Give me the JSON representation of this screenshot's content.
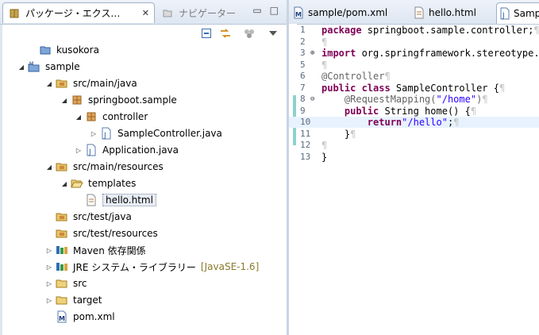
{
  "left_panel": {
    "tabs": [
      {
        "label": "パッケージ・エクス…",
        "close": "✕"
      },
      {
        "label": "ナビゲーター",
        "close": "✕"
      }
    ],
    "window_controls": {
      "minimize": "▭",
      "maximize": "□"
    },
    "toolbar_icons": [
      "collapse-all-icon",
      "link-with-editor-icon",
      "filters-icon",
      "view-menu-icon"
    ],
    "tree": [
      {
        "label": "kusokora"
      },
      {
        "label": "sample"
      },
      {
        "label": "src/main/java"
      },
      {
        "label": "springboot.sample"
      },
      {
        "label": "controller"
      },
      {
        "label": "SampleController.java"
      },
      {
        "label": "Application.java"
      },
      {
        "label": "src/main/resources"
      },
      {
        "label": "templates"
      },
      {
        "label": "hello.html"
      },
      {
        "label": "src/test/java"
      },
      {
        "label": "src/test/resources"
      },
      {
        "label": "Maven 依存関係"
      },
      {
        "label": "JRE システム・ライブラリー",
        "suffix": "[JavaSE-1.6]"
      },
      {
        "label": "src"
      },
      {
        "label": "target"
      },
      {
        "label": "pom.xml"
      }
    ]
  },
  "editor": {
    "tabs": [
      {
        "label": "sample/pom.xml"
      },
      {
        "label": "hello.html"
      },
      {
        "label": "SampleController.java"
      }
    ],
    "lines": [
      {
        "num": "1",
        "parts": [
          [
            "kw",
            "package"
          ],
          [
            "",
            "springboot.sample.controller;"
          ],
          [
            "pm",
            "¶"
          ]
        ]
      },
      {
        "num": "2",
        "parts": [
          [
            "pm",
            "¶"
          ]
        ]
      },
      {
        "num": "3",
        "parts": [
          [
            "kw",
            "import"
          ],
          [
            "",
            "org.springframework.stereotype.C"
          ]
        ],
        "fold": "⊕"
      },
      {
        "num": "5",
        "parts": [
          [
            "pm",
            "¶"
          ]
        ]
      },
      {
        "num": "6",
        "parts": [
          [
            "an",
            "@Controller"
          ],
          [
            "pm",
            "¶"
          ]
        ]
      },
      {
        "num": "7",
        "parts": [
          [
            "kw",
            "public class"
          ],
          [
            "",
            "SampleController {"
          ],
          [
            "pm",
            "¶"
          ]
        ]
      },
      {
        "num": "8",
        "parts": [
          [
            "an",
            "    @RequestMapping("
          ],
          [
            "st",
            "\"/home\""
          ],
          [
            "an",
            ")"
          ],
          [
            "pm",
            "¶"
          ]
        ],
        "fold": "⊖"
      },
      {
        "num": "9",
        "parts": [
          [
            "kw",
            "    public"
          ],
          [
            "",
            "String home() {"
          ],
          [
            "pm",
            "¶"
          ]
        ]
      },
      {
        "num": "10",
        "parts": [
          [
            "kw",
            "        return"
          ],
          [
            "st",
            "\"/hello\""
          ],
          [
            "",
            ";"
          ],
          [
            "pm",
            "¶"
          ]
        ],
        "current": true
      },
      {
        "num": "11",
        "parts": [
          [
            "",
            "    }"
          ],
          [
            "pm",
            "¶"
          ]
        ]
      },
      {
        "num": "12",
        "parts": [
          [
            "pm",
            "¶"
          ]
        ]
      },
      {
        "num": "13",
        "parts": [
          [
            "",
            "}"
          ]
        ]
      }
    ]
  }
}
